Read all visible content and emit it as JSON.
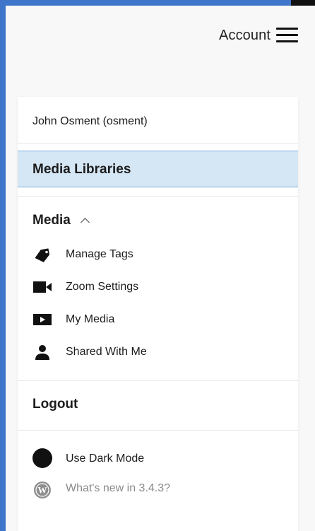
{
  "header": {
    "account_label": "Account",
    "menu_icon": "hamburger-menu-icon"
  },
  "menu": {
    "user_name": "John Osment (osment)",
    "libraries_label": "Media Libraries",
    "media_section": {
      "label": "Media",
      "chevron_icon": "chevron-up-icon",
      "items": [
        {
          "label": "Manage Tags",
          "icon": "tag-icon"
        },
        {
          "label": "Zoom Settings",
          "icon": "video-camera-icon"
        },
        {
          "label": "My Media",
          "icon": "play-box-icon"
        },
        {
          "label": "Shared With Me",
          "icon": "person-icon"
        }
      ]
    },
    "logout_label": "Logout",
    "dark_mode_label": "Use Dark Mode",
    "whats_new_label": "What's new in 3.4.3?",
    "whats_new_icon_letter": "W"
  },
  "colors": {
    "outer_frame": "#3f76c9",
    "page_background": "#f8f8f8",
    "selected_row_background": "#d5e6f4",
    "selected_row_border": "#7aaedb",
    "muted_text": "#8a8a8a"
  }
}
